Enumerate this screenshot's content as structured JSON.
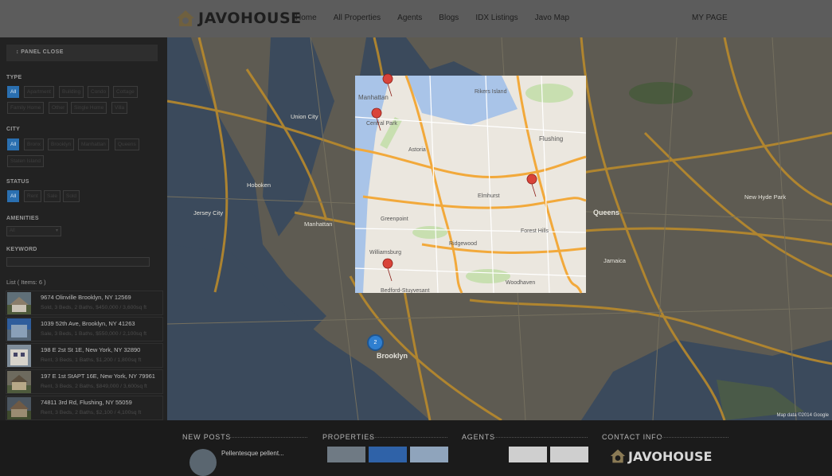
{
  "brand": {
    "logo_text": "JAVOHOUSE",
    "accent": "#7b6a4a"
  },
  "nav": [
    "Home",
    "All Properties",
    "Agents",
    "Blogs",
    "IDX Listings",
    "Javo Map"
  ],
  "my_page": "MY PAGE",
  "sidebar": {
    "panel_close": "↕ PANEL CLOSE",
    "type_title": "TYPE",
    "type_chips": [
      "All",
      "Apartment",
      "Building",
      "Condo",
      "Cottage",
      "Family Home",
      "Other",
      "Single Home",
      "Villa"
    ],
    "city_title": "CITY",
    "city_chips": [
      "All",
      "Bronx",
      "Brooklyn",
      "Manhattan",
      "Queens",
      "Staten Island"
    ],
    "status_title": "STATUS",
    "status_chips": [
      "All",
      "Rent",
      "Sale",
      "Sold"
    ],
    "amenities_title": "AMENITIES",
    "amenities_value": "All",
    "keyword_title": "KEYWORD",
    "list_count": "List ( Items: 6 )",
    "items": [
      {
        "title": "9674 Olinville Brooklyn, NY 12569",
        "sub": "Sold, 3 Beds, 2 Baths, $450,000 / 3,600sq ft"
      },
      {
        "title": "1039 52th Ave, Brooklyn, NY 41263",
        "sub": "Sale, 3 Beds, 1 Baths, $550,000 / 2,100sq ft"
      },
      {
        "title": "198 E 2st St 1E, New York, NY 32890",
        "sub": "Rent, 3 Beds, 1 Baths, $1,200 / 1,800sq ft"
      },
      {
        "title": "197 E 1st StAPT 16E, New York, NY 79961",
        "sub": "Rent, 3 Beds, 2 Baths, $849,000 / 3,600sq ft"
      },
      {
        "title": "74811 3rd Rd, Flushing, NY 55059",
        "sub": "Rent, 3 Beds, 2 Baths, $2,100 / 4,100sq ft"
      }
    ]
  },
  "map": {
    "attribution": "Map data ©2014 Google",
    "cluster_count": "2",
    "labels": [
      "Manhattan",
      "Union City",
      "Hoboken",
      "Jersey City",
      "Queens",
      "Brooklyn",
      "Flushing",
      "Astoria",
      "Jamaica",
      "Ridgewood",
      "Williamsburg",
      "Bedford-Stuyvesant",
      "Forest Hills",
      "New Hyde Park",
      "Elmhurst",
      "Woodhaven",
      "Greenpoint",
      "Rikers Island",
      "Central Park"
    ]
  },
  "footer": {
    "new_posts": "NEW POSTS",
    "post_text": "Pellentesque pellent...",
    "properties": "PROPERTIES",
    "agents": "AGENTS",
    "contact": "CONTACT INFO",
    "contact_logo": "JAVOHOUSE"
  }
}
